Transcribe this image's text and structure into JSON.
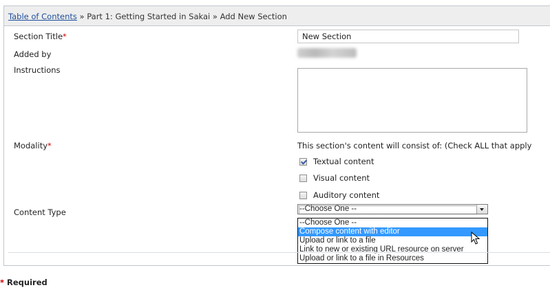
{
  "breadcrumb": {
    "root_link": "Table of Contents",
    "separator": "»",
    "part": "Part 1: Getting Started in Sakai",
    "current": "Add New Section"
  },
  "form": {
    "section_title_label": "Section Title",
    "required_mark": "*",
    "section_title_value": "New Section",
    "added_by_label": "Added by",
    "instructions_label": "Instructions",
    "modality_label": "Modality",
    "modality_hint": "This section's content will consist of: (Check ALL that apply",
    "modality_options": [
      {
        "label": "Textual content",
        "checked": true
      },
      {
        "label": "Visual content",
        "checked": false
      },
      {
        "label": "Auditory content",
        "checked": false
      }
    ],
    "content_type_label": "Content Type",
    "content_type_selected": "--Choose One --",
    "content_type_options": [
      {
        "label": "--Choose One --",
        "highlighted": false
      },
      {
        "label": "Compose content with editor",
        "highlighted": true
      },
      {
        "label": "Upload or link to a file",
        "highlighted": false
      },
      {
        "label": "Link to new or existing URL resource on server",
        "highlighted": false
      },
      {
        "label": "Upload or link to a file in Resources",
        "highlighted": false
      }
    ]
  },
  "footer": {
    "required_mark": "*",
    "required_label": "Required"
  },
  "colors": {
    "link": "#1f4e9c",
    "required": "#cc0000",
    "highlight": "#3399ff"
  }
}
